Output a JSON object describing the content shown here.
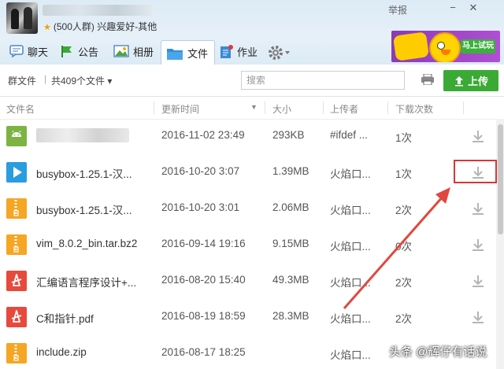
{
  "window": {
    "group_line": "(500人群) 兴趣爱好-其他",
    "report_label": "举报",
    "minimize": "−",
    "close": "✕"
  },
  "tabs": [
    {
      "label": "聊天",
      "icon": "chat-icon"
    },
    {
      "label": "公告",
      "icon": "flag-icon"
    },
    {
      "label": "相册",
      "icon": "photo-icon"
    },
    {
      "label": "文件",
      "icon": "folder-icon",
      "active": true
    },
    {
      "label": "作业",
      "icon": "homework-icon"
    }
  ],
  "ad": {
    "button_label": "马上试玩"
  },
  "toolbar": {
    "crumb_root": "群文件",
    "crumb_count": "共409个文件 ▾",
    "search_placeholder": "搜索",
    "upload_label": "上传"
  },
  "columns": {
    "name": "文件名",
    "time": "更新时间",
    "size": "大小",
    "uploader": "上传者",
    "downloads": "下载次数"
  },
  "files": [
    {
      "name": "",
      "time": "2016-11-02 23:49",
      "size": "293KB",
      "uploader": "#ifdef ...",
      "downloads": "1次",
      "icon": "android-icon"
    },
    {
      "name": "busybox-1.25.1-汉...",
      "time": "2016-10-20 3:07",
      "size": "1.39MB",
      "uploader": "火焰口...",
      "downloads": "1次",
      "icon": "play-icon"
    },
    {
      "name": "busybox-1.25.1-汉...",
      "time": "2016-10-20 3:01",
      "size": "2.06MB",
      "uploader": "火焰口...",
      "downloads": "2次",
      "icon": "zip-icon"
    },
    {
      "name": "vim_8.0.2_bin.tar.bz2",
      "time": "2016-09-14 19:16",
      "size": "9.15MB",
      "uploader": "火焰口...",
      "downloads": "0次",
      "icon": "zip-icon"
    },
    {
      "name": "汇编语言程序设计+...",
      "time": "2016-08-20 15:40",
      "size": "49.3MB",
      "uploader": "火焰口...",
      "downloads": "2次",
      "icon": "pdf-icon"
    },
    {
      "name": "C和指针.pdf",
      "time": "2016-08-19 18:59",
      "size": "28.3MB",
      "uploader": "火焰口...",
      "downloads": "2次",
      "icon": "pdf-icon"
    },
    {
      "name": "include.zip",
      "time": "2016-08-17 18:25",
      "size": "",
      "uploader": "火焰口...",
      "downloads": "",
      "icon": "zip-icon"
    }
  ],
  "watermark": "头条 @辉仔有话说",
  "colors": {
    "accent_green": "#3aaa35",
    "highlight_red": "#d93535",
    "arrow_red": "#e0483f"
  }
}
